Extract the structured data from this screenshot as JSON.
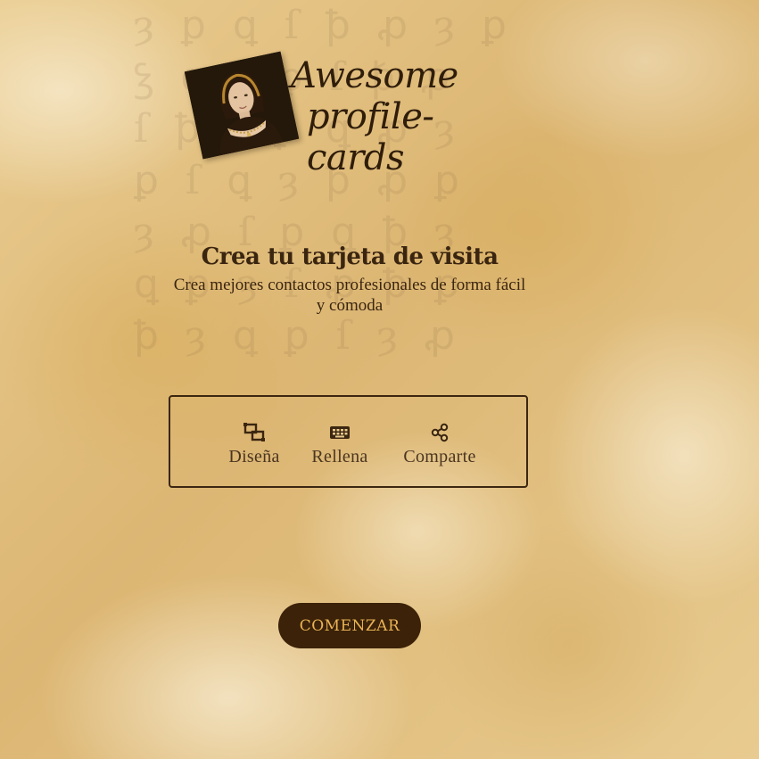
{
  "logo": {
    "line1": "Awesome",
    "line2": "profile-cards"
  },
  "hero": {
    "title": "Crea tu tarjeta de visita",
    "subtitle": "Crea mejores contactos profesionales de forma fácil y cómoda"
  },
  "features": [
    {
      "icon": "design-icon",
      "label": "Diseña"
    },
    {
      "icon": "keyboard-icon",
      "label": "Rellena"
    },
    {
      "icon": "share-icon",
      "label": "Comparte"
    }
  ],
  "cta": {
    "label": "COMENZAR"
  },
  "colors": {
    "ink": "#3b2611",
    "button_bg": "#3b2209",
    "button_text": "#eab354",
    "parchment": "#e6c98c"
  }
}
